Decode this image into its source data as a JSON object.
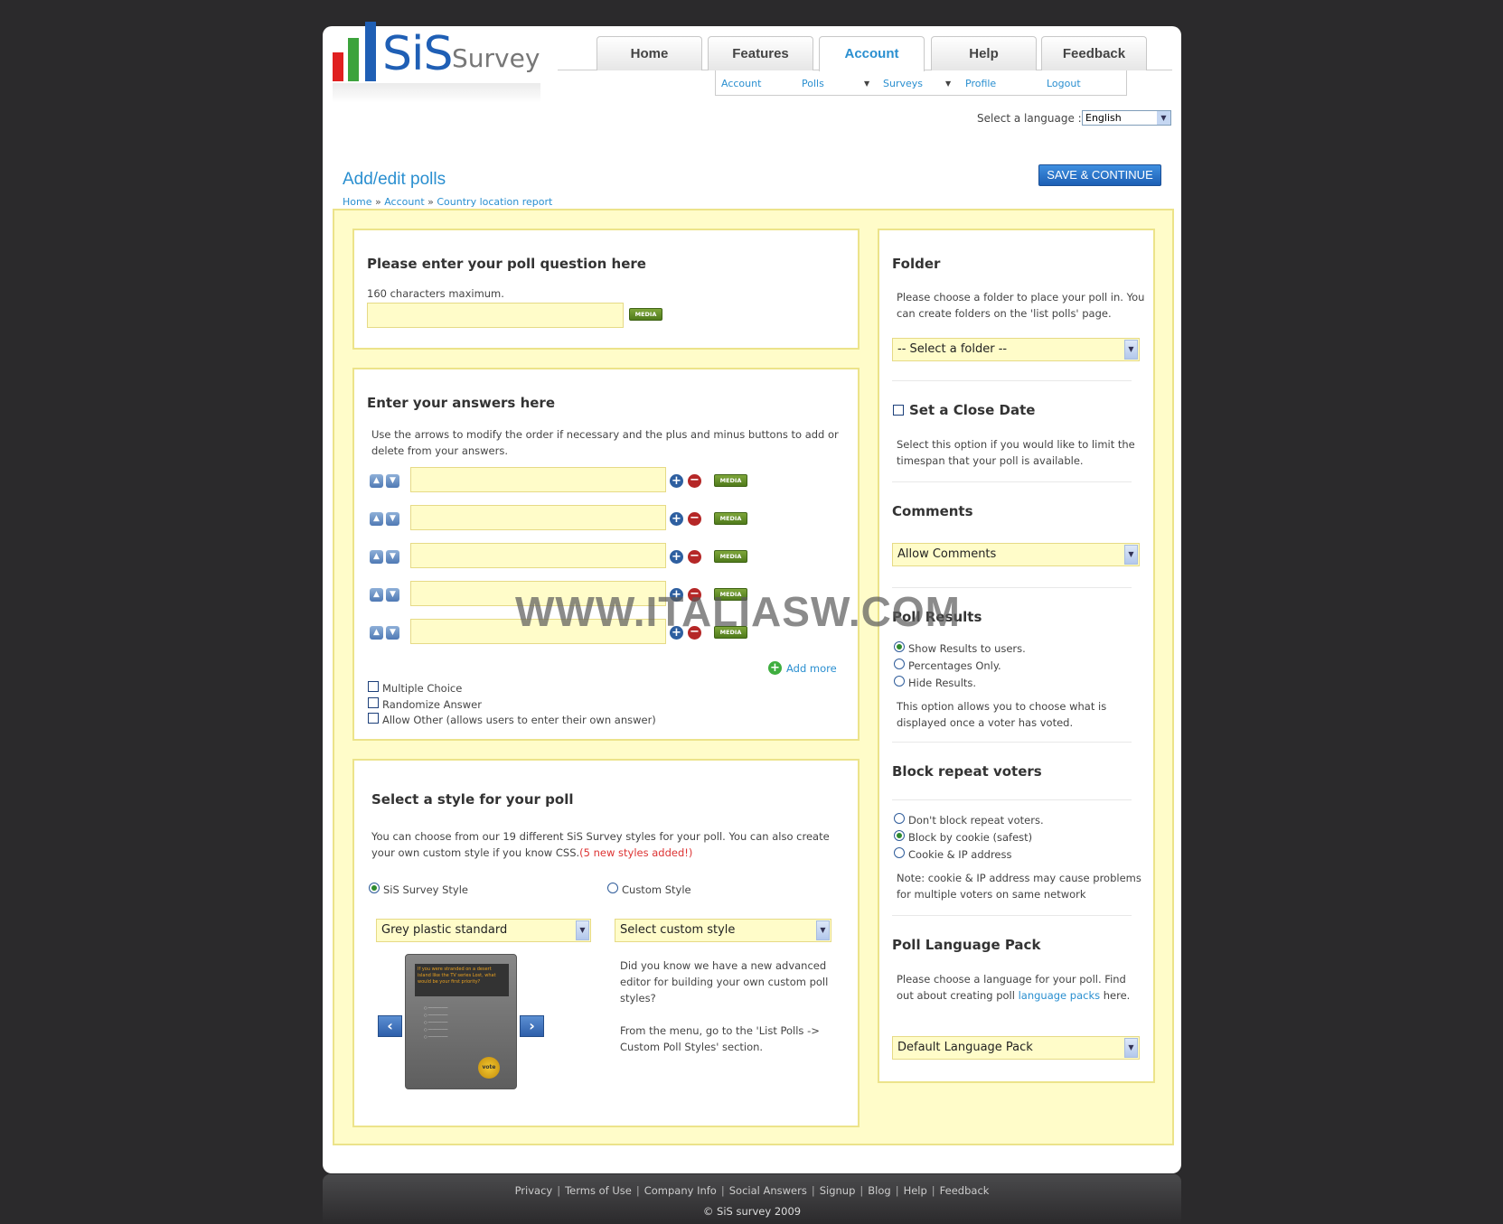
{
  "logo": {
    "sis": "SiS",
    "survey": "Survey"
  },
  "tabs": [
    "Home",
    "Features",
    "Account",
    "Help",
    "Feedback"
  ],
  "subnav": [
    "Account",
    "Polls",
    "Surveys",
    "Profile",
    "Logout"
  ],
  "language": {
    "label": "Select a language :",
    "value": "English"
  },
  "page": {
    "title": "Add/edit polls",
    "save_button": "SAVE & CONTINUE",
    "breadcrumb": [
      "Home",
      "Account",
      "Country location report"
    ],
    "breadcrumb_sep": "»"
  },
  "question": {
    "title": "Please enter your poll question here",
    "hint": "160 characters maximum.",
    "media": "MEDIA"
  },
  "answers": {
    "title": "Enter your answers here",
    "hint": "Use the arrows to modify the order if necessary and the plus and minus buttons to add or delete from your answers.",
    "media": "MEDIA",
    "add_more": "Add more",
    "options": [
      "Multiple Choice",
      "Randomize Answer",
      "Allow Other (allows users to enter their own answer)"
    ]
  },
  "style": {
    "title": "Select a style for your poll",
    "hint": "You can choose from our 19 different SiS Survey styles for your poll. You can also create your own custom style if you know CSS.",
    "hint_new": "(5 new styles added!)",
    "sis_label": "SiS Survey Style",
    "custom_label": "Custom Style",
    "sis_select": "Grey plastic standard",
    "custom_select": "Select custom style",
    "custom_info1": "Did you know we have a new advanced editor for building your own custom poll styles?",
    "custom_info2": "From the menu, go to the 'List Polls -> Custom Poll Styles' section.",
    "preview_text": "If you were stranded on a desert island like the TV series Lost, what would be your first priority?",
    "preview_vote": "vote"
  },
  "folder": {
    "title": "Folder",
    "hint": "Please choose a folder to place your poll in. You can create folders on the 'list polls' page.",
    "select": "-- Select a folder --"
  },
  "close_date": {
    "title": "Set a Close Date",
    "hint": "Select this option if you would like to limit the timespan that your poll is available."
  },
  "comments": {
    "title": "Comments",
    "select": "Allow Comments"
  },
  "results": {
    "title": "Poll Results",
    "options": [
      "Show Results to users.",
      "Percentages Only.",
      "Hide Results."
    ],
    "hint": "This option allows you to choose what is displayed once a voter has voted."
  },
  "block": {
    "title": "Block repeat voters",
    "options": [
      "Don't block repeat voters.",
      "Block by cookie (safest)",
      "Cookie & IP address"
    ],
    "note": "Note: cookie & IP address may cause problems for multiple voters on same network"
  },
  "langpack": {
    "title": "Poll Language Pack",
    "hint_a": "Please choose a language for your poll. Find out about creating poll",
    "hint_link": "language packs",
    "hint_b": "here.",
    "select": "Default Language Pack"
  },
  "watermark": "WWW.ITALIASW.COM",
  "footer": {
    "links": [
      "Privacy",
      "Terms of Use",
      "Company Info",
      "Social Answers",
      "Signup",
      "Blog",
      "Help",
      "Feedback"
    ],
    "copyright": "© SiS survey 2009"
  },
  "colors": {
    "accent": "#2a8fd0",
    "panel": "#fffcc9",
    "panel_border": "#ece38a",
    "background": "#2b2a2c"
  }
}
